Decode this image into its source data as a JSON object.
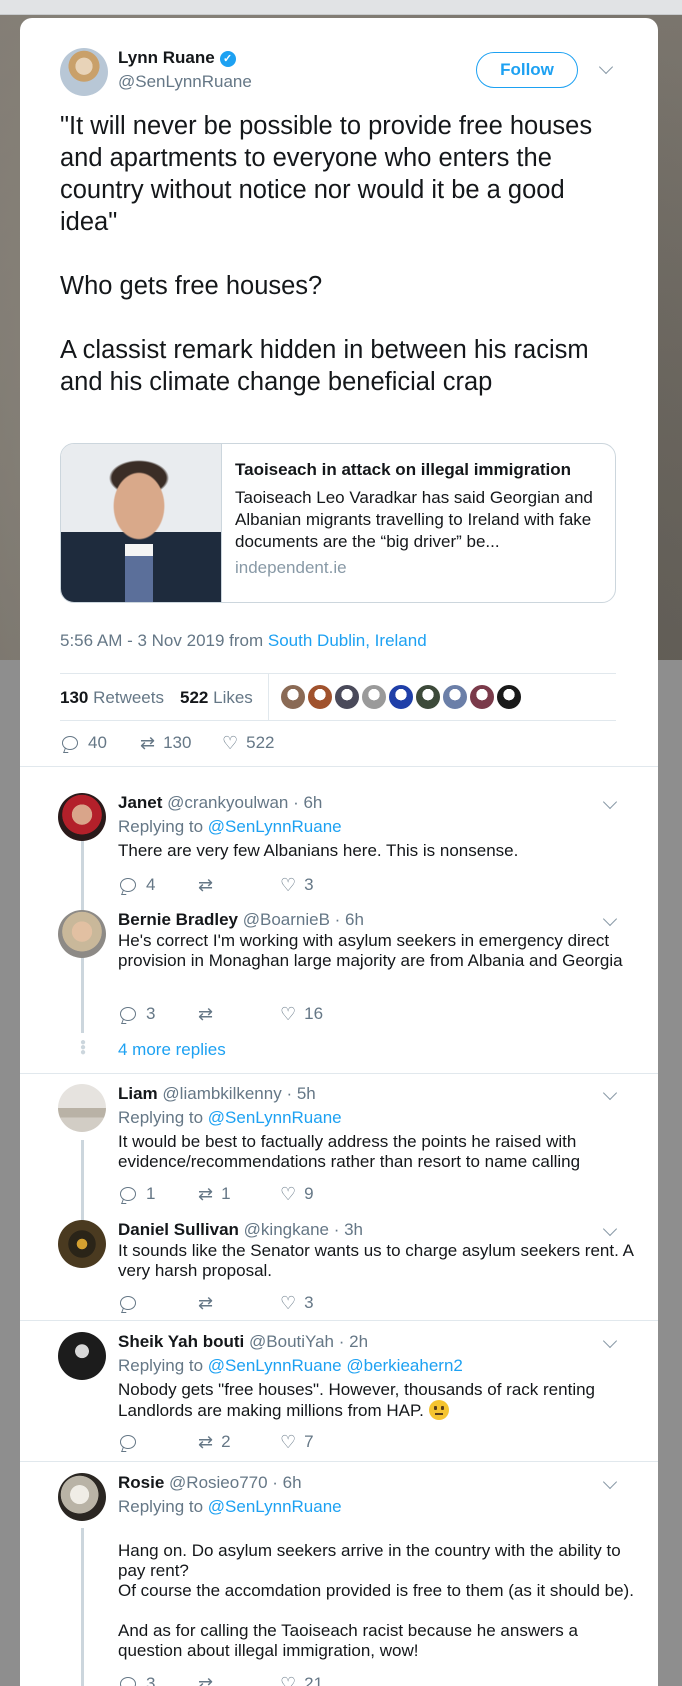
{
  "author": {
    "name": "Lynn Ruane",
    "handle": "@SenLynnRuane",
    "follow_label": "Follow"
  },
  "tweet": {
    "paragraphs": [
      "\"It will never be possible to provide free houses and apartments to everyone who enters the country without notice nor would it be a good idea\"",
      "Who gets free houses?",
      "A classist remark hidden in between his racism and his climate change beneficial crap"
    ]
  },
  "card": {
    "title": "Taoiseach in attack on illegal immigration",
    "description": "Taoiseach Leo Varadkar has said Georgian and Albanian migrants travelling to Ireland with fake documents are the “big driver” be...",
    "domain": "independent.ie"
  },
  "meta": {
    "time": "5:56 AM - 3 Nov 2019 from ",
    "location": "South Dublin, Ireland"
  },
  "stats": {
    "retweets_count": "130",
    "retweets_label": "Retweets",
    "likes_count": "522",
    "likes_label": "Likes"
  },
  "liker_colors": [
    "#8a6a55",
    "#a0522d",
    "#4a4a5a",
    "#9a9a9a",
    "#1f3fa8",
    "#3d4a3a",
    "#6b7fa8",
    "#7a3a4a",
    "#1a1a1a"
  ],
  "actions": {
    "replies": "40",
    "retweets": "130",
    "likes": "522"
  },
  "replies": [
    {
      "name": "Janet",
      "meta": "@crankyoulwan · 6h",
      "replying_prefix": "Replying to",
      "replying_to": "@SenLynnRuane",
      "text": [
        "There are very few Albanians here. This is nonsense."
      ],
      "counts": {
        "replies": "4",
        "retweets": "",
        "likes": "3"
      }
    },
    {
      "name": "Bernie Bradley",
      "meta": "@BoarnieB · 6h",
      "text": [
        "He's correct  I'm working with asylum seekers in emergency direct provision in Monaghan large majority are from Albania and Georgia"
      ],
      "counts": {
        "replies": "3",
        "retweets": "",
        "likes": "16"
      }
    },
    {
      "name": "Liam",
      "meta": "@liambkilkenny · 5h",
      "replying_prefix": "Replying to",
      "replying_to": "@SenLynnRuane",
      "text": [
        "It would be best to factually address the points he raised with evidence/recommendations rather than resort to name calling"
      ],
      "counts": {
        "replies": "1",
        "retweets": "1",
        "likes": "9"
      }
    },
    {
      "name": "Daniel Sullivan",
      "meta": "@kingkane · 3h",
      "text": [
        "It sounds like the Senator wants us to charge asylum seekers rent. A very harsh proposal."
      ],
      "counts": {
        "replies": "",
        "retweets": "",
        "likes": "3"
      }
    },
    {
      "name": "Sheik Yah bouti",
      "meta": "@BoutiYah · 2h",
      "replying_prefix": "Replying to",
      "replying_to": "@SenLynnRuane @berkieahern2",
      "text": [
        "Nobody gets \"free houses\". However,  thousands of rack renting Landlords are making millions from HAP."
      ],
      "counts": {
        "replies": "",
        "retweets": "2",
        "likes": "7"
      }
    },
    {
      "name": "Rosie",
      "meta": "@Rosieo770 · 6h",
      "replying_prefix": "Replying to",
      "replying_to": "@SenLynnRuane",
      "text": [
        "Hang on. Do asylum seekers arrive in the country with the ability to pay rent?\nOf course the accomdation provided is free to them (as it should be).",
        "And as for calling the Taoiseach racist because he answers a question about illegal immigration, wow!"
      ],
      "counts": {
        "replies": "3",
        "retweets": "",
        "likes": "21"
      }
    }
  ],
  "more_replies": "4 more replies"
}
